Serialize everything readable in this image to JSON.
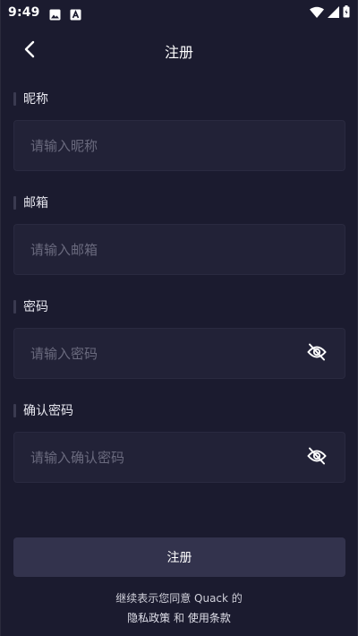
{
  "status_bar": {
    "time": "9:49",
    "icons": [
      "image-icon",
      "a-letter-icon",
      "wifi-icon",
      "signal-icon",
      "battery-icon"
    ]
  },
  "nav": {
    "title": "注册",
    "back_icon": "chevron-left-icon"
  },
  "form": {
    "nickname": {
      "label": "昵称",
      "placeholder": "请输入昵称",
      "value": ""
    },
    "email": {
      "label": "邮箱",
      "placeholder": "请输入邮箱",
      "value": ""
    },
    "password": {
      "label": "密码",
      "placeholder": "请输入密码",
      "value": "",
      "toggle_icon": "eye-off-icon"
    },
    "confirm_password": {
      "label": "确认密码",
      "placeholder": "请输入确认密码",
      "value": "",
      "toggle_icon": "eye-off-icon"
    }
  },
  "submit": {
    "label": "注册"
  },
  "terms": {
    "line1": "继续表示您同意 Quack 的",
    "privacy_link": "隐私政策",
    "and": "和",
    "terms_link": "使用条款"
  },
  "colors": {
    "background": "#1b1b2f",
    "input_bg": "#222237",
    "button_bg": "#33334d",
    "placeholder": "#6a6a7e"
  }
}
